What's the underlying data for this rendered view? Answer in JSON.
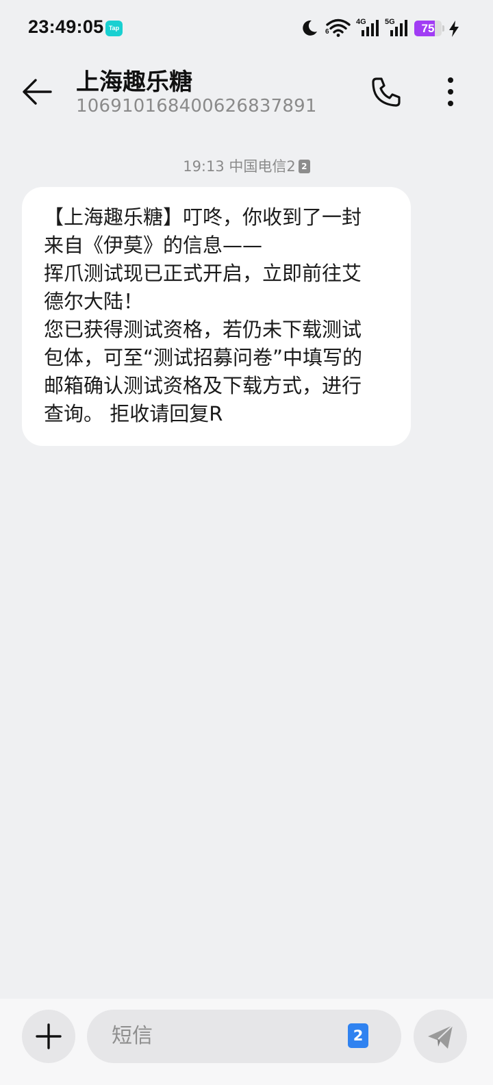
{
  "status_bar": {
    "time": "23:49:05",
    "app_badge": "Tap",
    "network_1": "4G",
    "network_2": "5G",
    "wifi_sub": "6",
    "battery_percent": 75,
    "battery_label": "75",
    "battery_color": "#a13cf4"
  },
  "header": {
    "title": "上海趣乐糖",
    "phone_number": "106910168400626837891",
    "back_icon": "arrow-left-icon",
    "call_icon": "phone-icon",
    "more_icon": "more-vertical-icon"
  },
  "conversation": {
    "timestamp": "19:13",
    "carrier": "中国电信2",
    "sim_slot": "2",
    "message": "【上海趣乐糖】叮咚，你收到了一封\n来自《伊莫》的信息——\n挥爪测试现已正式开启，立即前往艾\n德尔大陆！\n您已获得测试资格，若仍未下载测试\n包体，可至“测试招募问卷”中填写的\n邮箱确认测试资格及下载方式，进行\n查询。 拒收请回复R"
  },
  "input_bar": {
    "placeholder": "短信",
    "sim_slot": "2",
    "sim_color": "#2f82f0",
    "add_icon": "plus-icon",
    "send_icon": "send-icon"
  }
}
